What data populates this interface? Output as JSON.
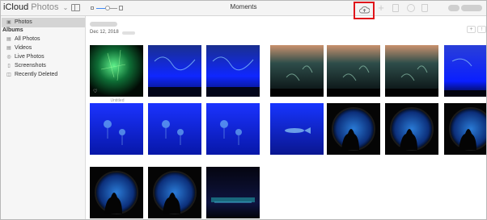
{
  "app": {
    "name_bold": "iCloud",
    "name_light": "Photos",
    "menu_chevron": "chevron-down-icon"
  },
  "toolbar": {
    "view_title": "Moments",
    "icons": [
      "sidebar-toggle-icon",
      "zoom-out-icon",
      "zoom-slider",
      "zoom-in-icon",
      "upload-icon",
      "add-icon",
      "share-icon",
      "favorite-icon",
      "delete-icon"
    ],
    "zoom_level": 0.5,
    "highlight_color": "#e0151b"
  },
  "sidebar": {
    "top_item": {
      "label": "Photos",
      "icon": "photos-icon",
      "selected": true
    },
    "albums_title": "Albums",
    "albums": [
      {
        "label": "All Photos",
        "icon": "album-icon"
      },
      {
        "label": "Videos",
        "icon": "video-icon"
      },
      {
        "label": "Live Photos",
        "icon": "live-photos-icon"
      },
      {
        "label": "Screenshots",
        "icon": "screenshot-icon"
      },
      {
        "label": "Recently Deleted",
        "icon": "trash-icon"
      }
    ]
  },
  "moment": {
    "date": "Dec 12, 2018",
    "add_label": "+",
    "share_icon": "share-icon"
  },
  "photos": [
    {
      "scene": "green",
      "favorite": true,
      "caption": "Untitled"
    },
    {
      "scene": "blue-water"
    },
    {
      "scene": "blue-water"
    },
    {
      "scene": "warm-tank"
    },
    {
      "scene": "warm-tank"
    },
    {
      "scene": "warm-tank"
    },
    {
      "scene": "blue-tank"
    },
    {
      "scene": "jelly"
    },
    {
      "scene": "jelly"
    },
    {
      "scene": "jelly"
    },
    {
      "scene": "fish"
    },
    {
      "scene": "porthole"
    },
    {
      "scene": "porthole"
    },
    {
      "scene": "porthole"
    },
    {
      "scene": "porthole"
    },
    {
      "scene": "porthole"
    },
    {
      "scene": "dark-stage"
    }
  ],
  "favorite_icon": "heart-icon"
}
